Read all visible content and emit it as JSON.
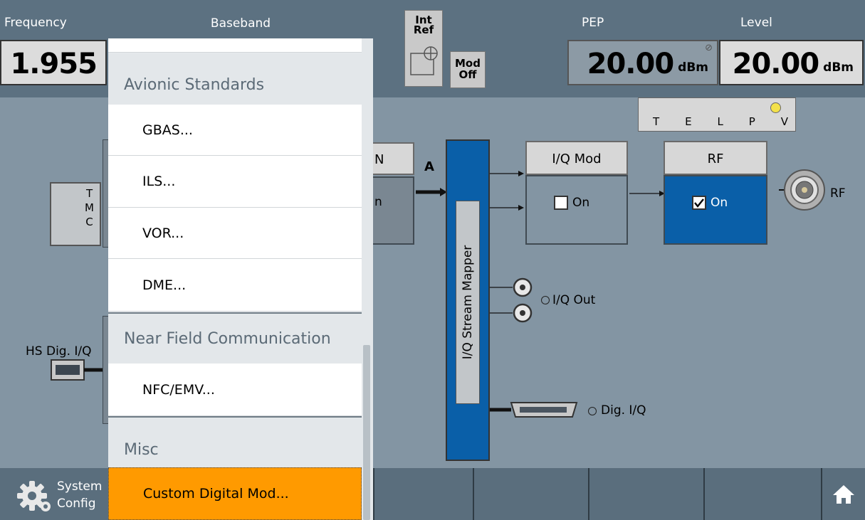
{
  "topbar": {
    "frequency_label": "Frequency",
    "frequency_value": "1.955",
    "int_ref": "Int\nRef",
    "mod_off": "Mod\nOff",
    "pep_label": "PEP",
    "pep_value": "20.00",
    "pep_unit": "dBm",
    "level_label": "Level",
    "level_value": "20.00",
    "level_unit": "dBm"
  },
  "status_leds": {
    "letters": [
      "T",
      "E",
      "L",
      "P",
      "V"
    ]
  },
  "diagram": {
    "tmc_label": "T\nM\nC",
    "hs_dig_iq_label": "HS Dig. I/Q",
    "path_a_label": "A",
    "partial_block_head": "N",
    "partial_block_text": "n",
    "stream_mapper_label": "I/Q Stream Mapper",
    "iq_mod": {
      "title": "I/Q Mod",
      "state_label": "On",
      "checked": false
    },
    "rf": {
      "title": "RF",
      "state_label": "On",
      "checked": true
    },
    "rf_connector_label": "RF",
    "iq_out_label": "I/Q Out",
    "dig_iq_label": "Dig. I/Q"
  },
  "menu": {
    "title": "Baseband",
    "sections": [
      {
        "category": "Avionic Standards",
        "items": [
          "GBAS...",
          "ILS...",
          "VOR...",
          "DME..."
        ]
      },
      {
        "category": "Near Field Communication",
        "items": [
          "NFC/EMV..."
        ]
      },
      {
        "category": "Misc",
        "items": [
          "Custom Digital Mod..."
        ]
      }
    ],
    "highlighted_item": "Custom Digital Mod..."
  },
  "bottombar": {
    "system_config_line1": "System",
    "system_config_line2": "Config"
  },
  "colors": {
    "title_bar": "#5c7181",
    "diagram_bg": "#8395a3",
    "rf_active": "#0a5fa8",
    "highlight": "#ff9a00"
  }
}
